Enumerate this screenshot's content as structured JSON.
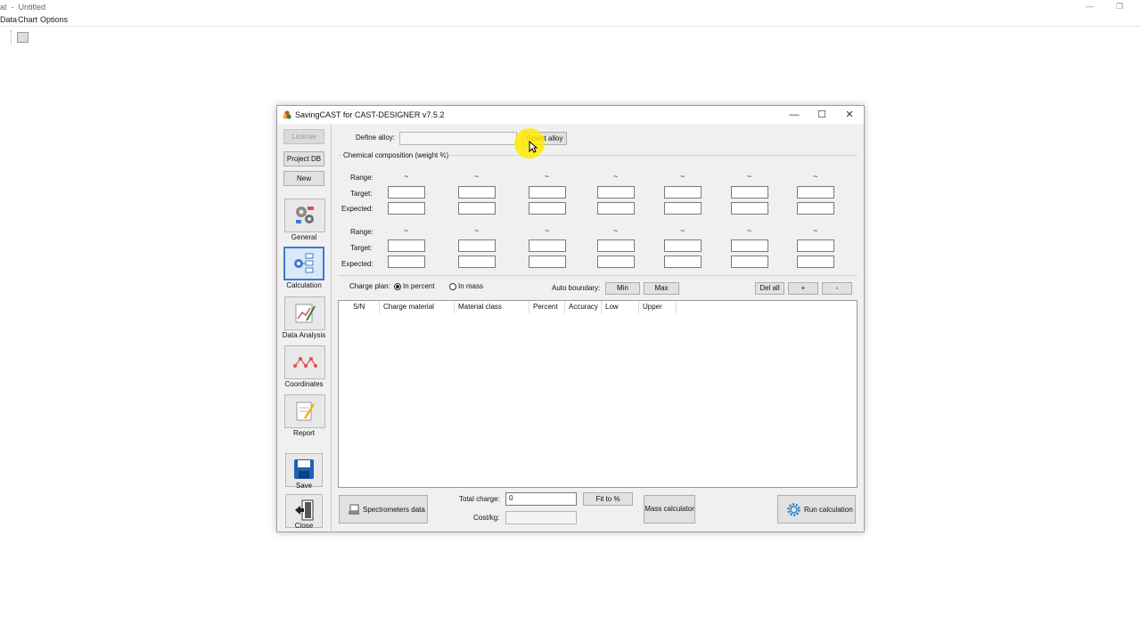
{
  "background_app": {
    "title": "at  -  Untitled",
    "menu": [
      "Data",
      "Chart",
      "Options"
    ],
    "minimize_glyph": "—",
    "restore_glyph": "❐"
  },
  "dialog": {
    "title": "SavingCAST for CAST-DESIGNER v7.5.2",
    "minimize_glyph": "—",
    "maximize_glyph": "☐",
    "close_glyph": "✕"
  },
  "sidebar": {
    "license": "License",
    "project_db": "Project DB",
    "new": "New",
    "nav": [
      {
        "label": "General",
        "icon": "general-icon"
      },
      {
        "label": "Calculation",
        "icon": "calculation-icon"
      },
      {
        "label": "Data Analysis",
        "icon": "data-analysis-icon"
      },
      {
        "label": "Coordinates",
        "icon": "coordinates-icon"
      },
      {
        "label": "Report",
        "icon": "report-icon"
      }
    ],
    "save": "Save",
    "close": "Close"
  },
  "form": {
    "define_alloy_label": "Define alloy:",
    "define_alloy_value": "",
    "select_alloy": "Select alloy",
    "chem_group_label": "Chemical composition (weight %)",
    "range_label": "Range:",
    "target_label": "Target:",
    "expected_label": "Expected:",
    "tilde": "~",
    "charge_plan_label": "Charge plan:",
    "in_percent": "In percent",
    "in_mass": "In mass",
    "charge_plan_selected": "In percent",
    "auto_boundary_label": "Auto boundary:",
    "min": "Min",
    "max": "Max",
    "del_all": "Del all",
    "plus": "+",
    "minus": "-"
  },
  "table": {
    "columns": [
      "S/N",
      "Charge material",
      "Material class",
      "Percent",
      "Accuracy",
      "Low",
      "Upper"
    ],
    "rows": []
  },
  "footer": {
    "spectrometers": "Spectrometers data",
    "total_charge_label": "Total charge:",
    "total_charge_value": "0",
    "fit": "Fit to %",
    "cost_label": "Cost/kg:",
    "cost_value": "",
    "mass_calculator": "Mass calculator",
    "run_calculation": "Run calculation"
  },
  "colors": {
    "accent": "#3a7bd5",
    "cursor_highlight": "#ffeb00"
  }
}
